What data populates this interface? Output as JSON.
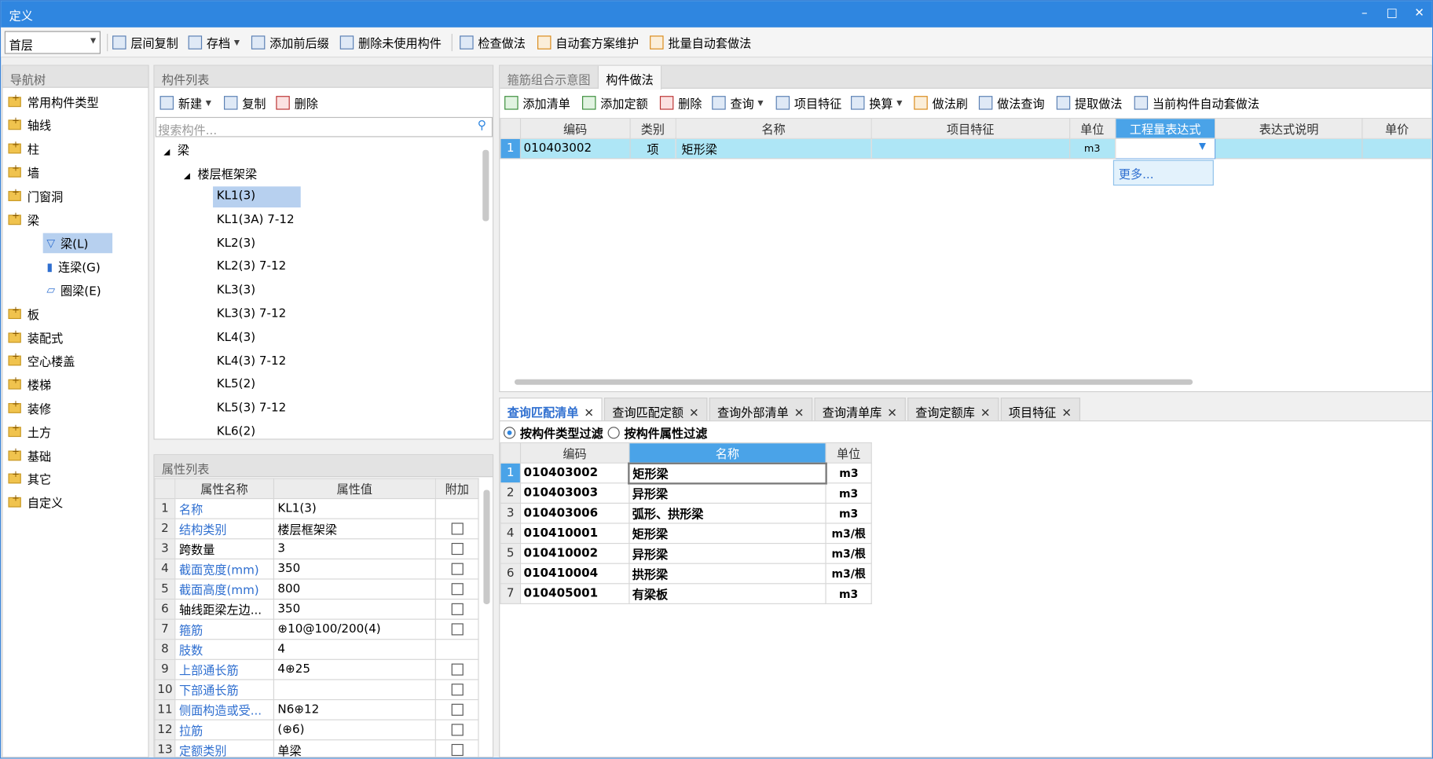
{
  "window": {
    "title": "定义",
    "minimize": "–",
    "maximize": "□",
    "close": "✕"
  },
  "toolbar": {
    "floor": "首层",
    "buttons": [
      "层间复制",
      "存档",
      "添加前后缀",
      "删除未使用构件",
      "检查做法",
      "自动套方案维护",
      "批量自动套做法"
    ]
  },
  "nav": {
    "title": "导航树",
    "items": [
      "常用构件类型",
      "轴线",
      "柱",
      "墙",
      "门窗洞",
      "梁",
      "板",
      "装配式",
      "空心楼盖",
      "楼梯",
      "装修",
      "土方",
      "基础",
      "其它",
      "自定义"
    ],
    "beam_children": [
      "梁(L)",
      "连梁(G)",
      "圈梁(E)"
    ]
  },
  "component_list": {
    "title": "构件列表",
    "actions": [
      "新建",
      "复制",
      "删除"
    ],
    "search_placeholder": "搜索构件...",
    "root": "梁",
    "group": "楼层框架梁",
    "items": [
      "KL1(3)",
      "KL1(3A) 7-12",
      "KL2(3)",
      "KL2(3) 7-12",
      "KL3(3)",
      "KL3(3) 7-12",
      "KL4(3)",
      "KL4(3) 7-12",
      "KL5(2)",
      "KL5(3) 7-12",
      "KL6(2)"
    ]
  },
  "props": {
    "title": "属性列表",
    "headers": [
      "属性名称",
      "属性值",
      "附加"
    ],
    "rows": [
      {
        "n": "1",
        "name": "名称",
        "val": "KL1(3)",
        "blue": true,
        "chk": false
      },
      {
        "n": "2",
        "name": "结构类别",
        "val": "楼层框架梁",
        "blue": true,
        "chk": true
      },
      {
        "n": "3",
        "name": "跨数量",
        "val": "3",
        "blue": false,
        "chk": true
      },
      {
        "n": "4",
        "name": "截面宽度(mm)",
        "val": "350",
        "blue": true,
        "chk": true
      },
      {
        "n": "5",
        "name": "截面高度(mm)",
        "val": "800",
        "blue": true,
        "chk": true
      },
      {
        "n": "6",
        "name": "轴线距梁左边...",
        "val": "350",
        "blue": false,
        "chk": true
      },
      {
        "n": "7",
        "name": "箍筋",
        "val": "⊕10@100/200(4)",
        "blue": true,
        "chk": true
      },
      {
        "n": "8",
        "name": "肢数",
        "val": "4",
        "blue": true,
        "chk": false
      },
      {
        "n": "9",
        "name": "上部通长筋",
        "val": "4⊕25",
        "blue": true,
        "chk": true
      },
      {
        "n": "10",
        "name": "下部通长筋",
        "val": "",
        "blue": true,
        "chk": true
      },
      {
        "n": "11",
        "name": "侧面构造或受...",
        "val": "N6⊕12",
        "blue": true,
        "chk": true
      },
      {
        "n": "12",
        "name": "拉筋",
        "val": "(⊕6)",
        "blue": true,
        "chk": true
      },
      {
        "n": "13",
        "name": "定额类别",
        "val": "单梁",
        "blue": true,
        "chk": true
      }
    ]
  },
  "method": {
    "tabs": [
      "箍筋组合示意图",
      "构件做法"
    ],
    "actions": [
      "添加清单",
      "添加定额",
      "删除",
      "查询",
      "项目特征",
      "换算",
      "做法刷",
      "做法查询",
      "提取做法",
      "当前构件自动套做法"
    ],
    "headers": [
      "编码",
      "类别",
      "名称",
      "项目特征",
      "单位",
      "工程量表达式",
      "表达式说明",
      "单价"
    ],
    "row": {
      "n": "1",
      "code": "010403002",
      "type": "项",
      "name": "矩形梁",
      "feature": "",
      "unit": "m3",
      "expr": "",
      "desc": "",
      "price": ""
    },
    "dropdown_more": "更多..."
  },
  "query": {
    "tabs": [
      "查询匹配清单",
      "查询匹配定额",
      "查询外部清单",
      "查询清单库",
      "查询定额库",
      "项目特征"
    ],
    "filter_type": "按构件类型过滤",
    "filter_attr": "按构件属性过滤",
    "headers": [
      "编码",
      "名称",
      "单位"
    ],
    "rows": [
      {
        "n": "1",
        "code": "010403002",
        "name": "矩形梁",
        "unit": "m3"
      },
      {
        "n": "2",
        "code": "010403003",
        "name": "异形梁",
        "unit": "m3"
      },
      {
        "n": "3",
        "code": "010403006",
        "name": "弧形、拱形梁",
        "unit": "m3"
      },
      {
        "n": "4",
        "code": "010410001",
        "name": "矩形梁",
        "unit": "m3/根"
      },
      {
        "n": "5",
        "code": "010410002",
        "name": "异形梁",
        "unit": "m3/根"
      },
      {
        "n": "6",
        "code": "010410004",
        "name": "拱形梁",
        "unit": "m3/根"
      },
      {
        "n": "7",
        "code": "010405001",
        "name": "有梁板",
        "unit": "m3"
      }
    ]
  }
}
